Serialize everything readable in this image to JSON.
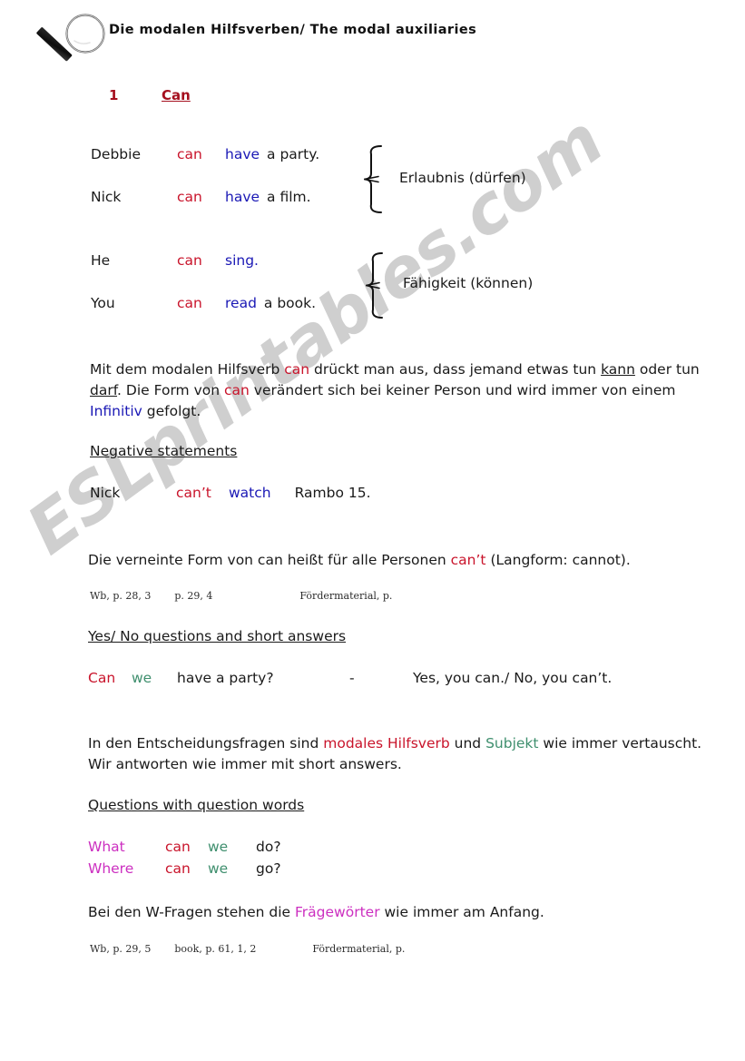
{
  "document": {
    "title": "Die modalen Hilfsverben/ The modal auxiliaries",
    "watermark": "ESLprintables.com"
  },
  "section": {
    "number": "1",
    "name": "Can"
  },
  "examples_permission": {
    "rows": [
      {
        "subject": "Debbie",
        "modal": "can",
        "verb": "have",
        "rest": "a party."
      },
      {
        "subject": "Nick",
        "modal": "can",
        "verb": "have",
        "rest": "a film."
      }
    ],
    "brace_label": "Erlaubnis  (dürfen)"
  },
  "examples_ability": {
    "rows": [
      {
        "subject": "He",
        "modal": "can",
        "verb": "sing.",
        "rest": ""
      },
      {
        "subject": "You",
        "modal": "can",
        "verb": "read",
        "rest": "a book."
      }
    ],
    "brace_label": "Fähigkeit (können)"
  },
  "explanation_can": {
    "part1": "Mit dem modalen Hilfsverb ",
    "can1": "can",
    "part2": " drückt man aus, dass jemand etwas tun ",
    "kann": "kann",
    "part3": " oder tun ",
    "darf": "darf",
    "part4": ". Die Form von ",
    "can2": "can",
    "part5": " verändert sich bei keiner Person und wird immer von einem ",
    "infinitiv": "Infinitiv",
    "part6": " gefolgt."
  },
  "negative": {
    "heading": "Negative statements",
    "row": {
      "subject": "Nick",
      "modal": "can’t",
      "verb": "watch",
      "rest": "Rambo 15."
    },
    "explanation_part1": "Die verneinte Form von can heißt für alle Personen ",
    "explanation_cant": "can’t",
    "explanation_part2": " (Langform: cannot).",
    "refs": [
      "Wb, p. 28, 3",
      "p. 29, 4",
      "Fördermaterial, p."
    ]
  },
  "yesno": {
    "heading": "Yes/ No questions and short answers",
    "q_modal": "Can",
    "q_subject": "we",
    "q_rest": "have  a  party?",
    "dash": "-",
    "answers": "Yes, you can./ No, you can’t.",
    "explanation_part1": "In den Entscheidungsfragen sind ",
    "explanation_modal": "modales Hilfsverb",
    "explanation_part2": "  und ",
    "explanation_subject": "Subjekt",
    "explanation_part3": "  wie immer vertauscht. Wir antworten wie immer mit short answers."
  },
  "qwords": {
    "heading": "Questions with question words",
    "rows": [
      {
        "word": "What",
        "modal": "can",
        "subject": "we",
        "verb": "do?"
      },
      {
        "word": "Where",
        "modal": "can",
        "subject": "we",
        "verb": "go?"
      }
    ],
    "explanation_part1": "Bei den W-Fragen stehen die ",
    "explanation_highlight": "Frägewörter",
    "explanation_part2": " wie immer am Anfang.",
    "refs": [
      "Wb, p. 29, 5",
      "book, p. 61, 1, 2",
      "Fördermaterial, p."
    ]
  },
  "colors": {
    "modal_red": "#c9142b",
    "verb_blue": "#1a18b5",
    "subject_green": "#3f8f6e",
    "question_word_magenta": "#cc2fc0",
    "section_dark_red": "#a50f1e",
    "watermark_gray": "#cfcfcf"
  }
}
